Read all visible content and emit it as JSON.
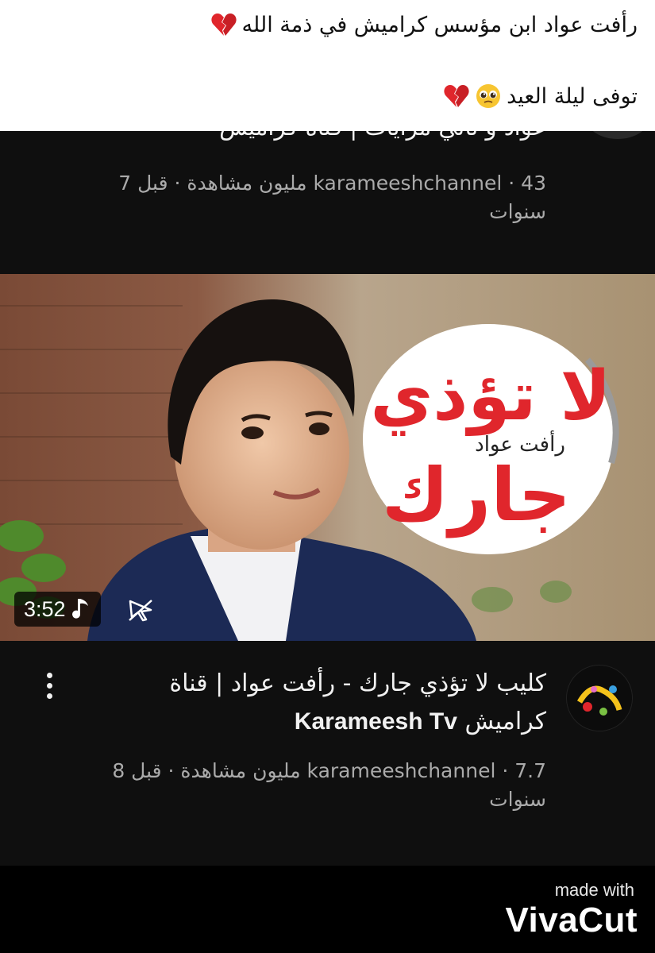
{
  "caption": {
    "line1": "رأفت عواد ابن مؤسس كراميش في ذمة الله",
    "line2": "توفى ليلة العيد"
  },
  "previous_video": {
    "title": "عواد و تالي مرايات | قناة كراميش",
    "meta": "karameeshchannel · 43 مليون مشاهدة · قبل 7 سنوات"
  },
  "thumbnail": {
    "duration": "3:52",
    "logo_main": "لا تؤذي",
    "logo_sub": "رأفت عواد",
    "logo_bottom": "جارك"
  },
  "video": {
    "title_ar": "كليب لا تؤذي جارك - رأفت عواد | قناة كراميش",
    "title_en": "Karameesh Tv",
    "meta": "karameeshchannel · 7.7 مليون مشاهدة · قبل 8 سنوات"
  },
  "watermark": {
    "made_with": "made with",
    "brand": "VivaCut"
  },
  "colors": {
    "feed_bg": "#0f0f0f",
    "meta_text": "#aaaaaa",
    "logo_red": "#e0262c"
  },
  "icons": [
    "broken-heart-icon",
    "pleading-face-icon",
    "music-note-icon",
    "cast-icon",
    "more-vert-icon"
  ]
}
